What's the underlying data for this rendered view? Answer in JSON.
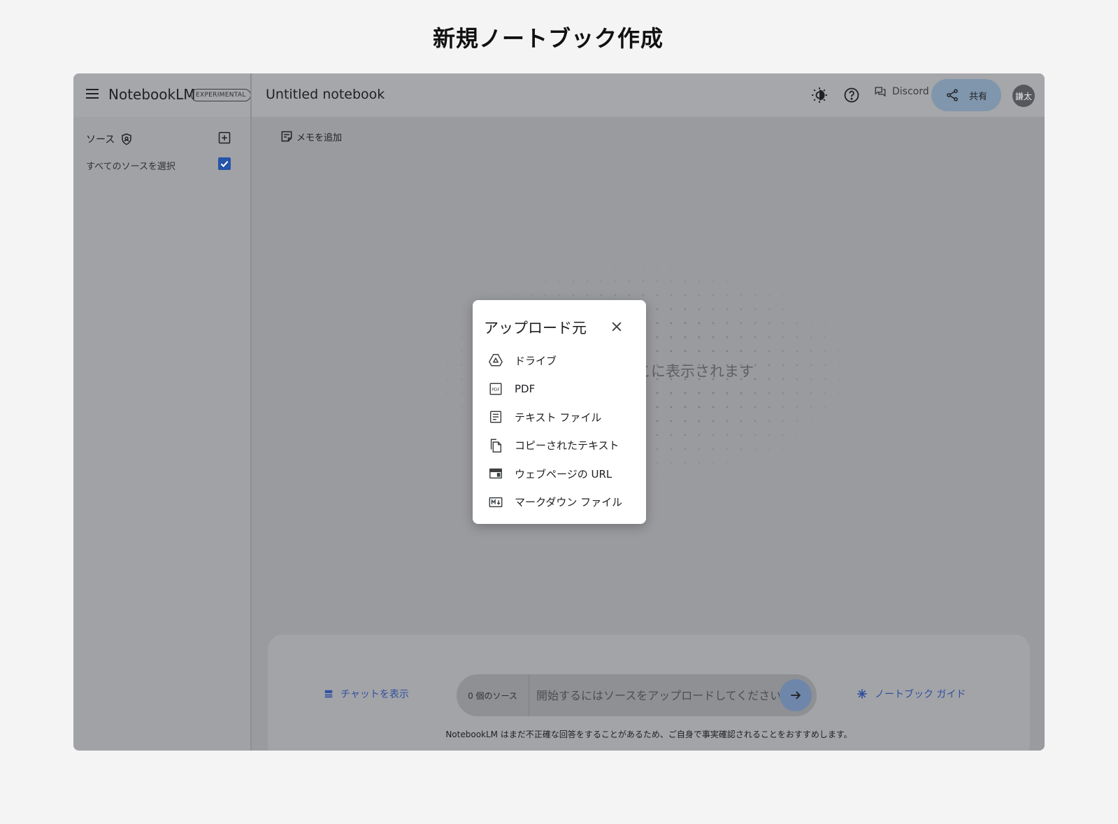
{
  "page_heading": "新規ノートブック作成",
  "header": {
    "brand": "NotebookLM",
    "badge": "EXPERIMENTAL",
    "notebook_title": "Untitled notebook",
    "discord_label": "Discord",
    "share_label": "共有",
    "avatar_text": "謙太"
  },
  "sidebar": {
    "sources_label": "ソース",
    "select_all_label": "すべてのソースを選択",
    "select_all_checked": true
  },
  "main": {
    "add_memo_label": "メモを追加",
    "empty_state_text": "こに表示されます"
  },
  "bottom": {
    "show_chat_label": "チャットを表示",
    "source_count_label": "0 個のソース",
    "chat_placeholder": "開始するにはソースをアップロードしてください",
    "notebook_guide_label": "ノートブック ガイド",
    "disclaimer": "NotebookLM はまだ不正確な回答をすることがあるため、ご自身で事実確認されることをおすすめします。"
  },
  "dialog": {
    "title": "アップロード元",
    "items": [
      {
        "label": "ドライブ",
        "icon": "drive-icon"
      },
      {
        "label": "PDF",
        "icon": "pdf-icon"
      },
      {
        "label": "テキスト ファイル",
        "icon": "text-file-icon"
      },
      {
        "label": "コピーされたテキスト",
        "icon": "copy-icon"
      },
      {
        "label": "ウェブページの URL",
        "icon": "webpage-icon"
      },
      {
        "label": "マークダウン ファイル",
        "icon": "markdown-icon"
      }
    ]
  },
  "colors": {
    "accent_blue": "#2f4fa0",
    "checkbox_blue": "#2555a8",
    "overlay_gray": "#9a9b9e"
  }
}
